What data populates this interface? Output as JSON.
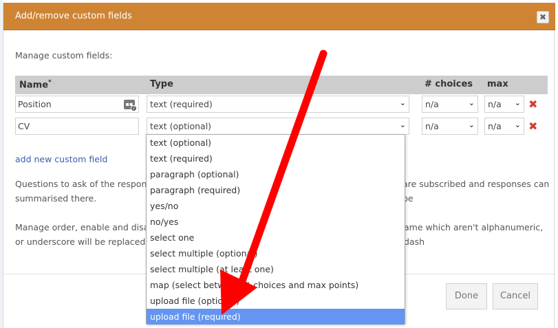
{
  "dialog": {
    "title": "Add/remove custom fields",
    "close_symbol": "✖",
    "intro": "Manage custom fields:"
  },
  "table": {
    "headers": {
      "name": "Name",
      "name_marker": "*",
      "type": "Type",
      "choices": "# choices",
      "max": "max"
    },
    "rows": [
      {
        "name": "Position",
        "type": "text (required)",
        "choices": "n/a",
        "max": "n/a",
        "delete_symbol": "✖"
      },
      {
        "name": "CV",
        "type": "text (optional)",
        "choices": "n/a",
        "max": "n/a",
        "delete_symbol": "✖"
      }
    ],
    "name_icon": "edit-count-icon",
    "name_icon_badge": "2"
  },
  "add_link": "add new custom field",
  "paragraphs": {
    "p1_line1_left": "Questions to ask of the respondent, a",
    "p1_line1_right": "are subscribed and responses can be",
    "p1_line2": "summarised there.",
    "p2_line1_left": "Manage order, enable and disable cu",
    "p2_line1_right": "ame which aren't alphanumeric, dash",
    "p2_line2": "or underscore will be replaced with a"
  },
  "dropdown": {
    "options": [
      "text (optional)",
      "text (required)",
      "paragraph (optional)",
      "paragraph (required)",
      "yes/no",
      "no/yes",
      "select one",
      "select multiple (optional)",
      "select multiple (at least one)",
      "map (select between # choices and max points)",
      "upload file (optional)",
      "upload file (required)"
    ],
    "selected_index": 11
  },
  "buttons": {
    "done": "Done",
    "cancel": "Cancel"
  },
  "colors": {
    "titlebar": "#cf8434",
    "arrow": "#ff0000",
    "highlight": "#6495f0",
    "delete": "#d63c2f",
    "link": "#3a5fa8"
  },
  "icons": {
    "chevron": "chevron-down-icon",
    "delete": "delete-icon",
    "close": "close-icon"
  }
}
